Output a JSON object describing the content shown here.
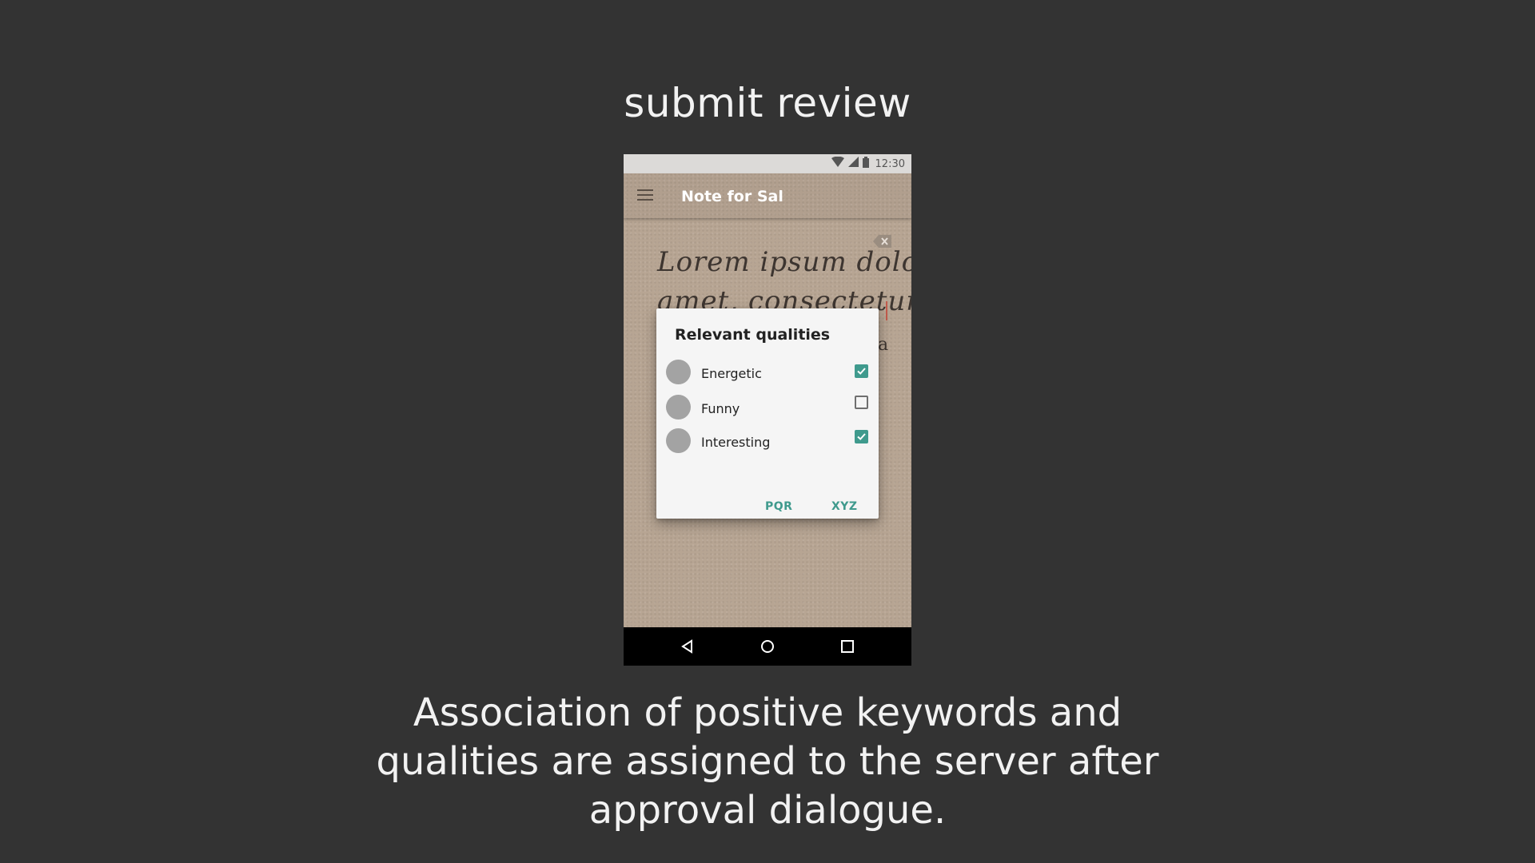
{
  "slide": {
    "title": "submit review",
    "caption": "Association of positive keywords and qualities are assigned to the server after approval dialogue."
  },
  "statusbar": {
    "time": "12:30",
    "icons": [
      "wifi-icon",
      "cell-signal-icon",
      "battery-icon"
    ]
  },
  "appbar": {
    "title": "Note for Sal",
    "menu_icon": "hamburger-menu-icon"
  },
  "note": {
    "line1": "Lorem ipsum dolor sit",
    "line2": "amet, consectetur",
    "fragment": "a",
    "clear_icon": "backspace-icon"
  },
  "dialog": {
    "title": "Relevant qualities",
    "items": [
      {
        "label": "Energetic",
        "checked": true
      },
      {
        "label": "Funny",
        "checked": false
      },
      {
        "label": "Interesting",
        "checked": true
      }
    ],
    "buttons": {
      "secondary": "PQR",
      "primary": "XYZ"
    }
  },
  "navbar": {
    "icons": [
      "back-icon",
      "home-icon",
      "recents-icon"
    ]
  },
  "colors": {
    "background": "#333333",
    "accent": "#3f9a8d",
    "paper": "#b7a593",
    "avatar": "#a3a3a3"
  }
}
